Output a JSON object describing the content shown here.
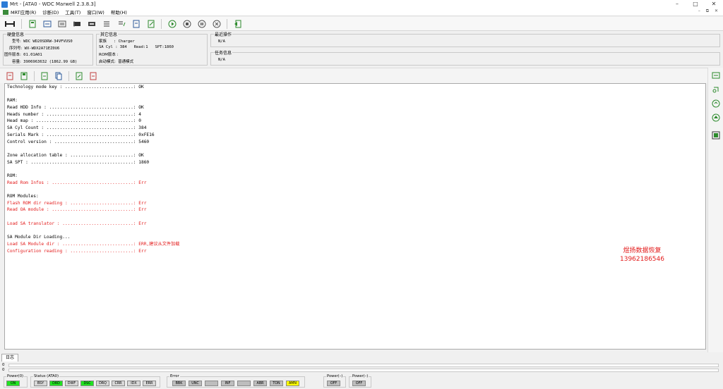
{
  "window": {
    "title": "Mrt - [ATA0 - WDC Marwell 2.3.8.3]",
    "controls": [
      "–",
      "□",
      "✕"
    ]
  },
  "menu": {
    "items": [
      "MRT应用(R)",
      "诊断(D)",
      "工具(T)",
      "窗口(W)",
      "帮助(H)"
    ],
    "mdi": "– ⧉ ✕"
  },
  "disk_info": {
    "title": "硬盘信息",
    "model_label": "型号:",
    "model": "WDC WD20SDRW-34VFVUS0",
    "serial_label": "序列号:",
    "serial": "WX-WDX2A71EZ0U6",
    "firmware_label": "固件版本:",
    "firmware": "01.01A01",
    "capacity_label": "容量:",
    "capacity": "3906963632 (1862.99 GB)"
  },
  "other_info": {
    "title": "其它信息",
    "family_label": "家族",
    "family": ": Charger",
    "sacyl_label": "SA Cyl",
    "sacyl": ": 384",
    "read_label": "Read:1",
    "spt_label": "SPT:1860",
    "rom_label": "ROM版本 :",
    "rom": "",
    "mode_label": "启动模式:",
    "mode": "普通模式"
  },
  "recent_op": {
    "title": "最近操作",
    "value": "N/A"
  },
  "task_info": {
    "title": "任务信息",
    "value": "N/A"
  },
  "log_lines": [
    {
      "text": "Technology mode key : ..........................: OK",
      "red": false
    },
    {
      "text": "",
      "red": false
    },
    {
      "text": "RAM:",
      "red": false
    },
    {
      "text": "Read HDD Info : ................................: OK",
      "red": false
    },
    {
      "text": "Heads number : .................................: 4",
      "red": false
    },
    {
      "text": "Head map : .....................................: 0",
      "red": false
    },
    {
      "text": "SA Cyl Count : .................................: 384",
      "red": false
    },
    {
      "text": "Serials Mark : .................................: 0xFE16",
      "red": false
    },
    {
      "text": "Control version : ..............................: 5460",
      "red": false
    },
    {
      "text": "",
      "red": false
    },
    {
      "text": "Zone allocation table : ........................: OK",
      "red": false
    },
    {
      "text": "SA SPT : .......................................: 1860",
      "red": false
    },
    {
      "text": "",
      "red": false
    },
    {
      "text": "ROM:",
      "red": false
    },
    {
      "text": "Read Rom Infos : ...............................: Err",
      "red": true
    },
    {
      "text": "",
      "red": false
    },
    {
      "text": "ROM Modules:",
      "red": false
    },
    {
      "text": "Flash ROM dir reading : ........................: Err",
      "red": true
    },
    {
      "text": "Read OA module : ...............................: Err",
      "red": true
    },
    {
      "text": "",
      "red": false
    },
    {
      "text": "Load SA translator : ...........................: Err",
      "red": true
    },
    {
      "text": "",
      "red": false
    },
    {
      "text": "SA Module Dir Loading...",
      "red": false
    },
    {
      "text": "Load SA Module dir : ...........................: ERR,建议从文件加载",
      "red": true
    },
    {
      "text": "Configuration reading : ........................: Err",
      "red": true
    }
  ],
  "watermark": {
    "line1": "煜扬数据恢复",
    "line2": "13962186546"
  },
  "tabs": {
    "log": "日志"
  },
  "progress": {
    "top": "0",
    "bottom": "0"
  },
  "status": {
    "power0_title": "Power(0)",
    "power0": "ON",
    "status_title": "Status (ATA0)",
    "status_leds": [
      "BSY",
      "DRD",
      "DWF",
      "DSC",
      "DRQ",
      "CRR",
      "IDX",
      "ERR"
    ],
    "error_title": "Error",
    "error_leds": [
      "BBK",
      "UNC",
      "",
      "INF",
      "",
      "ABR",
      "TON",
      "AMN"
    ],
    "power_a_title": "Power(–)",
    "power_a": "OFF",
    "power_b_title": "Power(–)",
    "power_b": "OFF"
  },
  "colors": {
    "accent_red": "#e31b1b",
    "led_green": "#21e321",
    "led_yellow": "#ffff00"
  }
}
